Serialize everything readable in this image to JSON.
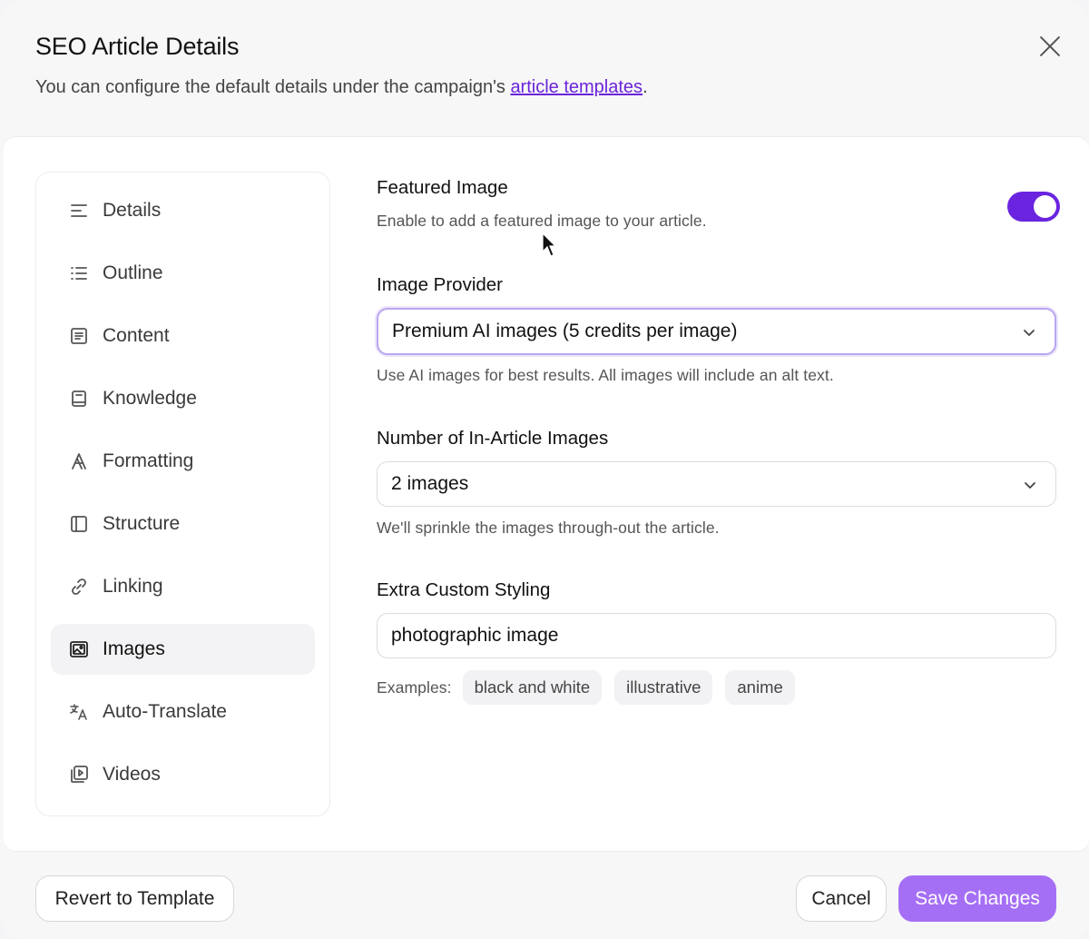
{
  "header": {
    "title": "SEO Article Details",
    "subtitle_prefix": "You can configure the default details under the campaign's ",
    "subtitle_link": "article templates",
    "subtitle_suffix": "."
  },
  "sidebar": {
    "items": [
      {
        "label": "Details",
        "icon": "align-left-icon"
      },
      {
        "label": "Outline",
        "icon": "list-icon"
      },
      {
        "label": "Content",
        "icon": "document-icon"
      },
      {
        "label": "Knowledge",
        "icon": "book-icon"
      },
      {
        "label": "Formatting",
        "icon": "font-icon"
      },
      {
        "label": "Structure",
        "icon": "layout-sidebar-icon"
      },
      {
        "label": "Linking",
        "icon": "link-icon"
      },
      {
        "label": "Images",
        "icon": "image-icon",
        "active": true
      },
      {
        "label": "Auto-Translate",
        "icon": "translate-icon"
      },
      {
        "label": "Videos",
        "icon": "video-icon"
      }
    ]
  },
  "featured_image": {
    "label": "Featured Image",
    "help": "Enable to add a featured image to your article.",
    "enabled": true
  },
  "image_provider": {
    "label": "Image Provider",
    "value": "Premium AI images (5 credits per image)",
    "help": "Use AI images for best results. All images will include an alt text."
  },
  "in_article_images": {
    "label": "Number of In-Article Images",
    "value": "2 images",
    "help": "We'll sprinkle the images through-out the article."
  },
  "custom_styling": {
    "label": "Extra Custom Styling",
    "value": "photographic image",
    "examples_label": "Examples:",
    "examples": [
      "black and white",
      "illustrative",
      "anime"
    ]
  },
  "footer": {
    "revert_label": "Revert to Template",
    "cancel_label": "Cancel",
    "save_label": "Save Changes"
  },
  "colors": {
    "accent": "#6a24e0",
    "save_button": "#a56ff5"
  }
}
